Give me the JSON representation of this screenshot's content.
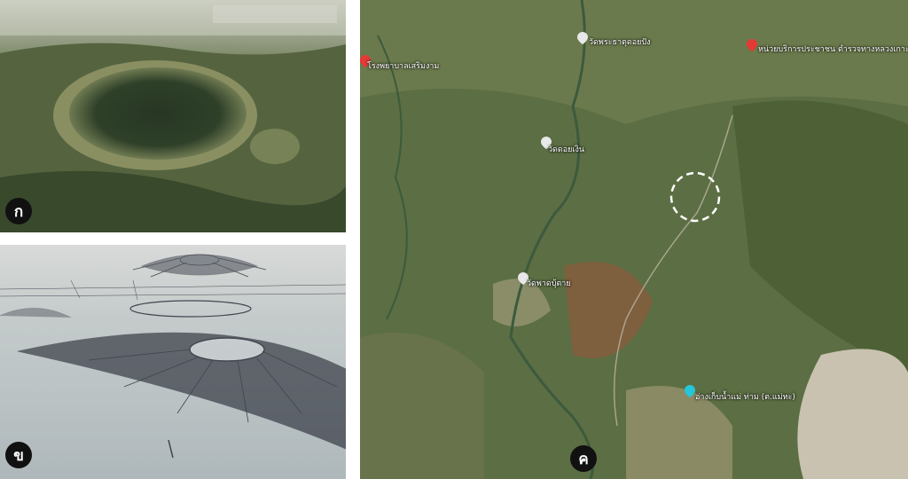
{
  "panels": {
    "a": {
      "badge": "ก"
    },
    "b": {
      "badge": "ข"
    },
    "c": {
      "badge": "ค"
    }
  },
  "map": {
    "places": [
      {
        "label": "วัดพระธาตุดอยปัง",
        "pin_color": "#e8e8e8"
      },
      {
        "label": "หน่วยบริการประชาชน ตำรวจทางหลวงเกาะคา",
        "pin_color": "#e53935"
      },
      {
        "label": "โรงพยาบาลเสริมงาม",
        "pin_color": "#e53935"
      },
      {
        "label": "วัดดอยเงิน",
        "pin_color": "#e8e8e8"
      },
      {
        "label": "วัดพาดบุ้ตาย",
        "pin_color": "#e8e8e8"
      },
      {
        "label": "อ่างเก็บน้ำแม่ ท่าม (ต.แม่ทะ)",
        "pin_color": "#26c6da"
      }
    ],
    "highlight": "dashed-circle"
  },
  "colors": {
    "badge_bg": "#111111",
    "badge_text": "#ffffff",
    "highlight": "#ffffff"
  }
}
